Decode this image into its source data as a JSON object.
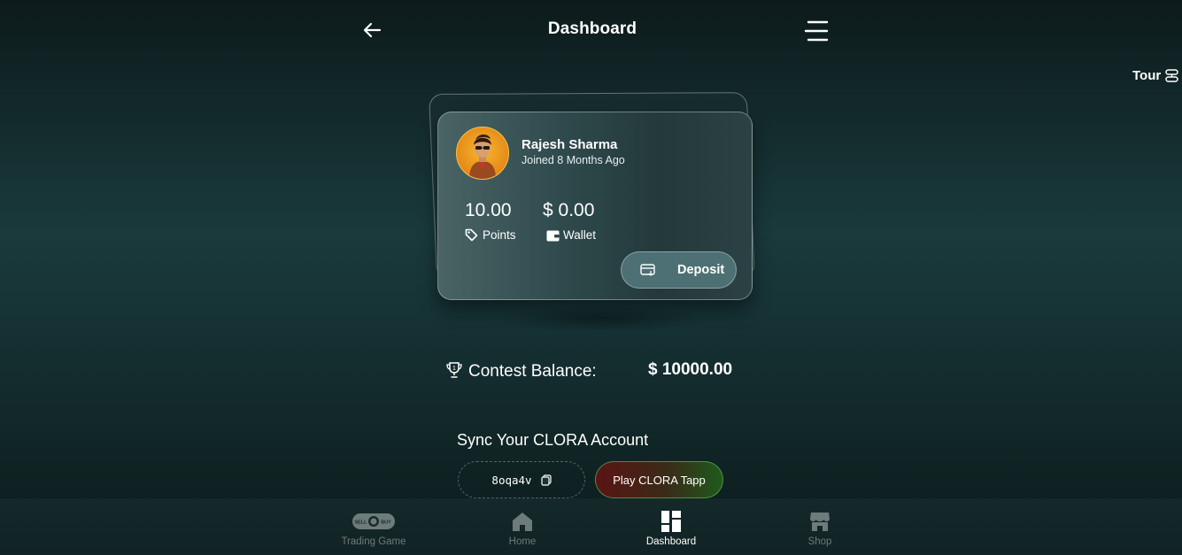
{
  "header": {
    "title": "Dashboard",
    "back_icon": "arrow-left-icon",
    "menu_icon": "hamburger-menu-icon"
  },
  "tour": {
    "label": "Tour",
    "icon": "tour-icon"
  },
  "profile": {
    "name": "Rajesh Sharma",
    "joined": "Joined 8 Months Ago",
    "avatar": "avatar"
  },
  "stats": {
    "points_value": "10.00",
    "points_label": "Points",
    "wallet_value": "$ 0.00",
    "wallet_label": "Wallet"
  },
  "deposit": {
    "label": "Deposit",
    "icon": "card-deposit-icon"
  },
  "contest": {
    "label": "Contest Balance:",
    "value": "$ 10000.00",
    "icon": "trophy-icon"
  },
  "sync": {
    "title": "Sync Your CLORA Account",
    "code": "8oqa4v",
    "copy_icon": "copy-icon",
    "play_label": "Play CLORA Tapp"
  },
  "nav": {
    "items": [
      {
        "label": "Trading Game",
        "icon": "sell-buy-toggle-icon",
        "active": false
      },
      {
        "label": "Home",
        "icon": "home-icon",
        "active": false
      },
      {
        "label": "Dashboard",
        "icon": "dashboard-grid-icon",
        "active": true
      },
      {
        "label": "Shop",
        "icon": "shop-icon",
        "active": false
      }
    ]
  },
  "colors": {
    "background": "#12282a",
    "card": "#2f4a4c",
    "deposit_button": "#4d7074",
    "avatar_bg": "#e8901a"
  }
}
